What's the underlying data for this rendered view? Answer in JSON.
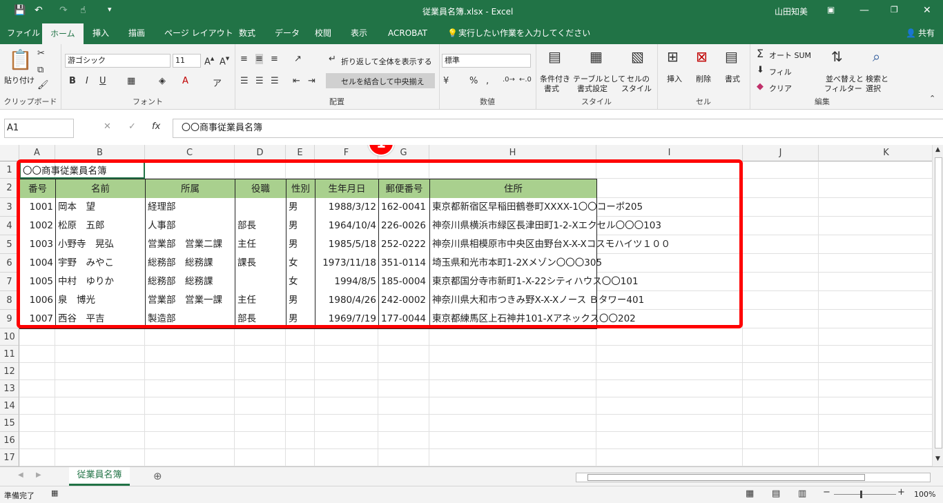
{
  "titlebar": {
    "title": "従業員名簿.xlsx  -  Excel",
    "user": "山田知美"
  },
  "tabs": [
    "ファイル",
    "ホーム",
    "挿入",
    "描画",
    "ページ レイアウト",
    "数式",
    "データ",
    "校閲",
    "表示",
    "ACROBAT"
  ],
  "tell_me": "実行したい作業を入力してください",
  "share": "共有",
  "ribbon": {
    "clipboard": {
      "paste": "貼り付け",
      "label": "クリップボード"
    },
    "font": {
      "name": "游ゴシック",
      "size": "11",
      "label": "フォント"
    },
    "alignment": {
      "wrap": "折り返して全体を表示する",
      "merge": "セルを結合して中央揃え",
      "label": "配置"
    },
    "number": {
      "format": "標準",
      "label": "数値"
    },
    "styles": {
      "cond1": "条件付き",
      "cond2": "書式",
      "table1": "テーブルとして",
      "table2": "書式設定",
      "cell1": "セルの",
      "cell2": "スタイル",
      "label": "スタイル"
    },
    "cells": {
      "insert": "挿入",
      "delete": "削除",
      "format": "書式",
      "label": "セル"
    },
    "editing": {
      "autosum": "オート SUM",
      "fill": "フィル",
      "clear": "クリア",
      "sort1": "並べ替えと",
      "sort2": "フィルター",
      "find1": "検索と",
      "find2": "選択",
      "label": "編集"
    }
  },
  "formula_bar": {
    "name_box": "A1",
    "content": "〇〇商事従業員名簿"
  },
  "annotation": "1",
  "columns": [
    "A",
    "B",
    "C",
    "D",
    "E",
    "F",
    "G",
    "H",
    "I",
    "J",
    "K"
  ],
  "rows": [
    "1",
    "2",
    "3",
    "4",
    "5",
    "6",
    "7",
    "8",
    "9",
    "10",
    "11",
    "12",
    "13",
    "14",
    "15",
    "16",
    "17"
  ],
  "sheet": {
    "title": "〇〇商事従業員名簿",
    "headers": [
      "番号",
      "名前",
      "所属",
      "役職",
      "性別",
      "生年月日",
      "郵便番号",
      "住所"
    ],
    "records": [
      [
        "1001",
        "岡本　望",
        "経理部",
        "",
        "男",
        "1988/3/12",
        "162-0041",
        "東京都新宿区早稲田鶴巻町XXXX-1〇〇コーポ205"
      ],
      [
        "1002",
        "松原　五郎",
        "人事部",
        "部長",
        "男",
        "1964/10/4",
        "226-0026",
        "神奈川県横浜市緑区長津田町1-2-Xエクセル〇〇〇103"
      ],
      [
        "1003",
        "小野寺　晃弘",
        "営業部　営業二課",
        "主任",
        "男",
        "1985/5/18",
        "252-0222",
        "神奈川県相模原市中央区由野台X-X-Xコスモハイツ１００"
      ],
      [
        "1004",
        "宇野　みやこ",
        "総務部　総務課",
        "課長",
        "女",
        "1973/11/18",
        "351-0114",
        "埼玉県和光市本町1-2Xメゾン〇〇〇305"
      ],
      [
        "1005",
        "中村　ゆりか",
        "総務部　総務課",
        "",
        "女",
        "1994/8/5",
        "185-0004",
        "東京都国分寺市新町1-X-22シティハウス〇〇101"
      ],
      [
        "1006",
        "泉　博光",
        "営業部　営業一課",
        "主任",
        "男",
        "1980/4/26",
        "242-0002",
        "神奈川県大和市つきみ野X-X-Xノース Ｂタワー401"
      ],
      [
        "1007",
        "西谷　平吉",
        "製造部",
        "部長",
        "男",
        "1969/7/19",
        "177-0044",
        "東京都練馬区上石神井101-Xアネックス〇〇202"
      ]
    ]
  },
  "sheet_tab": "従業員名簿",
  "status": {
    "ready": "準備完了",
    "zoom": "100%"
  },
  "colors": {
    "excel_green": "#217346",
    "header_fill": "#a9d08e",
    "highlight": "#ff0000"
  }
}
